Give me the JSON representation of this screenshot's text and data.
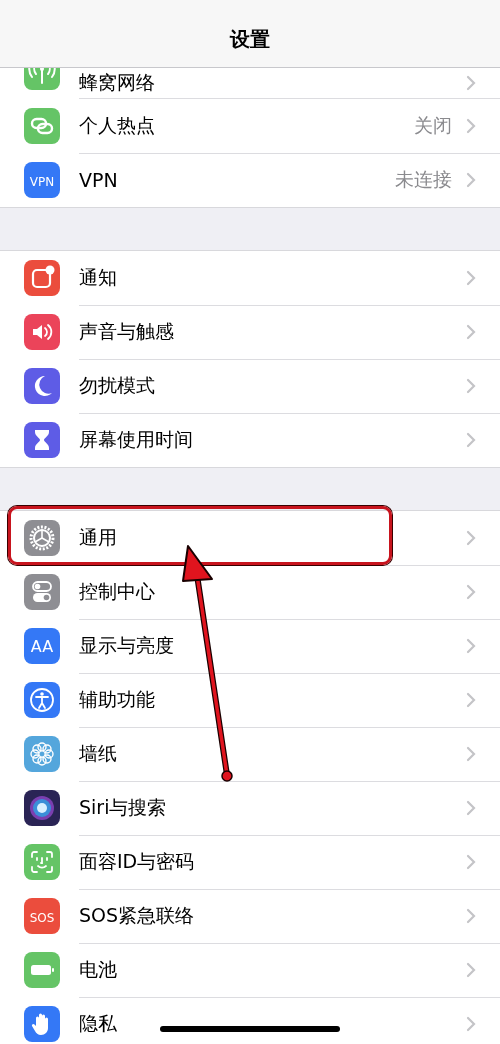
{
  "navigation_bar": {
    "title": "设置"
  },
  "sections": [
    {
      "rows": [
        {
          "label": "蜂窝网络",
          "kind": "antenna",
          "color": "#65c466",
          "highlighted": false
        },
        {
          "label": "个人热点",
          "value": "关闭",
          "kind": "links",
          "color": "#65c466",
          "highlighted": false
        },
        {
          "label": "VPN",
          "value": "未连接",
          "kind": "text",
          "icon_text": "VPN",
          "color": "#3478f6",
          "highlighted": false
        }
      ]
    },
    {
      "rows": [
        {
          "label": "通知",
          "kind": "notification",
          "color": "#eb4d3d",
          "highlighted": false
        },
        {
          "label": "声音与触感",
          "kind": "speaker",
          "color": "#eb445a",
          "highlighted": false
        },
        {
          "label": "勿扰模式",
          "kind": "moon",
          "color": "#5e5ce6",
          "highlighted": false
        },
        {
          "label": "屏幕使用时间",
          "kind": "hourglass",
          "color": "#5e5ce6",
          "highlighted": false
        }
      ]
    },
    {
      "rows": [
        {
          "label": "通用",
          "kind": "gear",
          "color": "#8e8e93",
          "highlighted": true
        },
        {
          "label": "控制中心",
          "kind": "toggles",
          "color": "#8e8e93",
          "highlighted": false
        },
        {
          "label": "显示与亮度",
          "kind": "text",
          "icon_text": "AA",
          "color": "#3478f6",
          "highlighted": false
        },
        {
          "label": "辅助功能",
          "kind": "figure",
          "color": "#3478f6",
          "highlighted": false
        },
        {
          "label": "墙纸",
          "kind": "flower",
          "color": "#54a6dc",
          "highlighted": false
        },
        {
          "label": "Siri与搜索",
          "kind": "orb",
          "color": "#2a2455",
          "highlighted": false
        },
        {
          "label": "面容ID与密码",
          "kind": "face-frame",
          "color": "#65c466",
          "highlighted": false
        },
        {
          "label": "SOS紧急联络",
          "kind": "text",
          "icon_text": "SOS",
          "color": "#eb4d3d",
          "highlighted": false
        },
        {
          "label": "电池",
          "kind": "battery",
          "color": "#65c466",
          "highlighted": false
        },
        {
          "label": "隐私",
          "kind": "hand",
          "color": "#3478f6",
          "highlighted": false
        }
      ]
    }
  ],
  "annotation": {
    "kind": "arrow"
  }
}
